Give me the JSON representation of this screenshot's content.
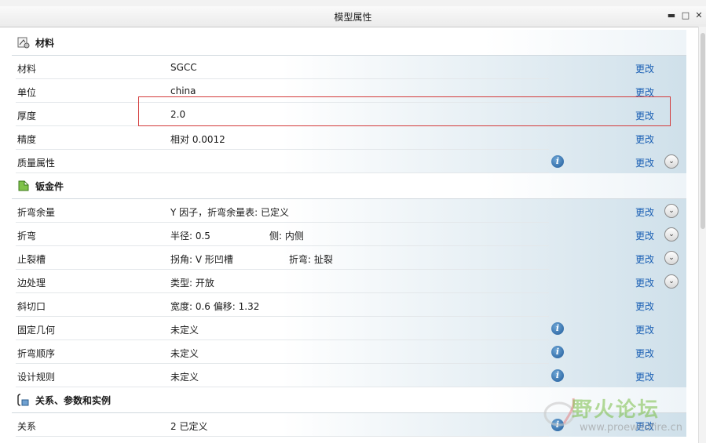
{
  "window": {
    "title": "模型属性",
    "minimize_glyph": "▬",
    "maximize_glyph": "□",
    "close_glyph": "✕"
  },
  "colors": {
    "link": "#1a5fb4",
    "highlight_box": "#d33a3a",
    "row_gradient_end": "#cfe0ea"
  },
  "sections": [
    {
      "title": "材料",
      "icon": "material-icon",
      "rows": [
        {
          "label": "材料",
          "value": "SGCC",
          "change": "更改"
        },
        {
          "label": "单位",
          "value": "china",
          "change": "更改"
        },
        {
          "label": "厚度",
          "value": "2.0",
          "change": "更改",
          "highlighted": true
        },
        {
          "label": "精度",
          "value": "相对 0.0012",
          "change": "更改"
        },
        {
          "label": "质量属性",
          "value": "",
          "change": "更改",
          "info": true,
          "expand": true
        }
      ]
    },
    {
      "title": "钣金件",
      "icon": "sheetmetal-icon",
      "rows": [
        {
          "label": "折弯余量",
          "value": "Y 因子，折弯余量表: 已定义",
          "change": "更改",
          "expand": true
        },
        {
          "label": "折弯",
          "value": "半径: 0.5",
          "value2": "侧: 内侧",
          "change": "更改",
          "expand": true
        },
        {
          "label": "止裂槽",
          "value": "拐角: V 形凹槽",
          "value2": "折弯: 扯裂",
          "change": "更改",
          "expand": true
        },
        {
          "label": "边处理",
          "value": "类型: 开放",
          "change": "更改",
          "expand": true
        },
        {
          "label": "斜切口",
          "value": "宽度: 0.6 偏移: 1.32",
          "change": "更改"
        },
        {
          "label": "固定几何",
          "value": "未定义",
          "change": "更改",
          "info": true
        },
        {
          "label": "折弯顺序",
          "value": "未定义",
          "change": "更改",
          "info": true
        },
        {
          "label": "设计规则",
          "value": "未定义",
          "change": "更改",
          "info": true
        }
      ]
    },
    {
      "title": "关系、参数和实例",
      "icon": "relations-icon",
      "rows": [
        {
          "label": "关系",
          "value": "2 已定义",
          "change": "更改",
          "info": true
        }
      ]
    }
  ],
  "watermark": {
    "text": "野火论坛",
    "url": "www.proewildfire.cn"
  }
}
